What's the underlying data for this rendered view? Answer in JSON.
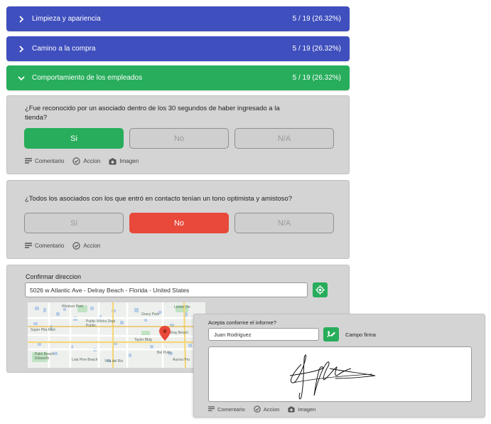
{
  "sections": [
    {
      "title": "Limpieza y apariencia",
      "score": "5 / 19 (26.32%)",
      "color": "#3f4fbd",
      "expanded": false
    },
    {
      "title": "Camino a la compra",
      "score": "5 / 19 (26.32%)",
      "color": "#3f4fbd",
      "expanded": false
    },
    {
      "title": "Comportamiento de los empleados",
      "score": "5 / 19 (26.32%)",
      "color": "#27ad5b",
      "expanded": true
    }
  ],
  "questions": [
    {
      "text": "¿Fue reconocido por un asociado dentro de los 30 segundos de haber ingresado a la tienda?",
      "options": [
        "Si",
        "No",
        "N/A"
      ],
      "selected": "Si",
      "actions": [
        "Comentario",
        "Accion",
        "Imagen"
      ]
    },
    {
      "text": "¿Todos los asociados con los que entró en contacto tenían un tono optimista y amistoso?",
      "options": [
        "Si",
        "No",
        "N/A"
      ],
      "selected": "No",
      "actions": [
        "Comentario",
        "Accion"
      ]
    }
  ],
  "address": {
    "label": "Confirmar direccion",
    "value": "5026 w Atlantic Ave - Delray Beach - Florida - United States",
    "map_labels": [
      "Windsor Park",
      "Public Works Dept",
      "Publix",
      "Gracy Park",
      "Super Pita Mart",
      "Loreto Vie",
      "Delray Beach",
      "Palm Beach",
      "Ellsworth",
      "Taylor Bldg",
      "Lola Pine Beach",
      "Aurora Pro",
      "Villa del Rio",
      "Bel Pulm"
    ]
  },
  "signature": {
    "question": "Acepta conforme el informe?",
    "name": "Juan Rodriguez",
    "field_label": "Campo firma",
    "actions": [
      "Comentario",
      "Accion",
      "Imagen"
    ]
  },
  "colors": {
    "blue": "#3f4fbd",
    "green": "#27ad5b",
    "red": "#e8493b",
    "card": "#d4d4d4"
  }
}
